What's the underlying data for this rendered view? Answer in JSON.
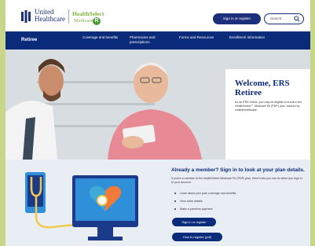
{
  "header": {
    "brand_line1": "United",
    "brand_line2": "Healthcare",
    "healthselect_line1": "HealthSelect",
    "healthselect_line2": "Medicare",
    "healthselect_badge": "R",
    "signin_label": "Sign in or register",
    "search_placeholder": "Search"
  },
  "nav": {
    "title": "Retiree",
    "items": [
      {
        "label": "Coverage and benefits"
      },
      {
        "label": "Pharmacies and prescriptions"
      },
      {
        "label": "Forms and Resources"
      },
      {
        "label": "Enrollment information"
      }
    ]
  },
  "hero": {
    "title": "Welcome, ERS Retiree",
    "body": "As an ERS retiree, you may be eligible to enroll in the HealthSelect℠ Medicare Rx (PDP) plan, insured by UnitedHealthcare."
  },
  "member": {
    "title": "Already a member? Sign in to look at your plan details.",
    "intro": "If you're a member of the HealthSelect Medicare Rx (PDP) plan, there's lots you can do when you sign in to your account.",
    "bullets": [
      "Learn about your plan coverage and benefits.",
      "View claim details.",
      "Make a premium payment."
    ],
    "signin_label": "Sign in or register",
    "register_label": "How to register (pdf)"
  },
  "colors": {
    "brand_navy": "#0a2a7a",
    "healthselect_green": "#7bb13a",
    "heart_orange": "#f07a3a",
    "heart_blue": "#3fa9d8"
  }
}
